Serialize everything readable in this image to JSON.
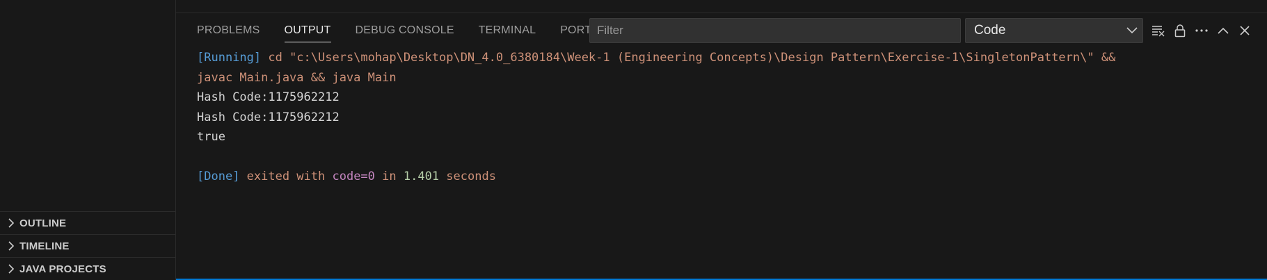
{
  "sidebar": {
    "sections": [
      {
        "label": "OUTLINE"
      },
      {
        "label": "TIMELINE"
      },
      {
        "label": "JAVA PROJECTS"
      }
    ]
  },
  "panel": {
    "tabs": [
      {
        "label": "PROBLEMS"
      },
      {
        "label": "OUTPUT"
      },
      {
        "label": "DEBUG CONSOLE"
      },
      {
        "label": "TERMINAL"
      },
      {
        "label": "PORTS"
      }
    ],
    "filter_placeholder": "Filter",
    "channel_selected": "Code",
    "actions": [
      "clear-output-icon",
      "lock-icon",
      "more-actions-icon",
      "maximize-panel-icon",
      "close-panel-icon"
    ]
  },
  "output": {
    "running_tag": "[Running]",
    "command_line1": " cd \"c:\\Users\\mohap\\Desktop\\DN_4.0_6380184\\Week-1 (Engineering Concepts)\\Design Pattern\\Exercise-1\\SingletonPattern\\\" &&",
    "command_line2": "javac Main.java && java Main",
    "lines": [
      "Hash Code:1175962212",
      "Hash Code:1175962212",
      "true"
    ],
    "done_tag": "[Done]",
    "exited_text": " exited with ",
    "code_key": "code=",
    "code_value": "0",
    "in_text": " in ",
    "duration": "1.401",
    "seconds_text": " seconds"
  },
  "colors": {
    "accent": "#0078d4",
    "tag": "#569cd6",
    "command": "#ce9178",
    "keyword": "#c586c0",
    "number": "#b5cea8"
  }
}
